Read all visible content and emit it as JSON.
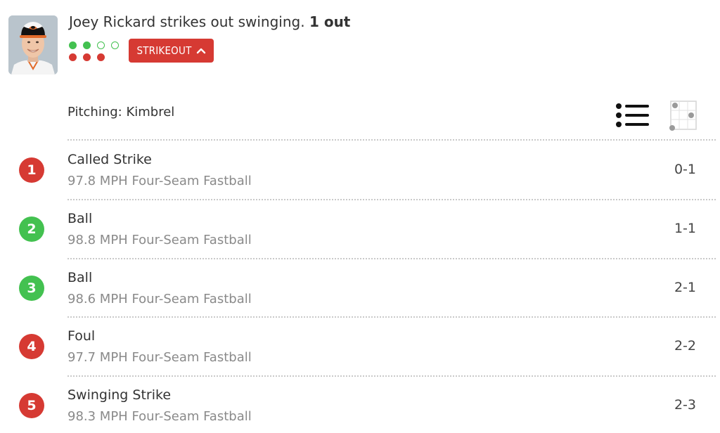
{
  "play": {
    "description": "Joey Rickard strikes out swinging.",
    "outs_text": "1 out",
    "result_badge": "STRIKEOUT",
    "balls": 2,
    "strikes": 3
  },
  "pitching": {
    "label": "Pitching: Kimbrel"
  },
  "view_toggle": {
    "list_icon": "list-icon",
    "zone_icon": "strike-zone-icon"
  },
  "pitches": [
    {
      "number": "1",
      "result": "Called Strike",
      "detail": "97.8 MPH Four-Seam Fastball",
      "count": "0-1",
      "color": "#d63a33"
    },
    {
      "number": "2",
      "result": "Ball",
      "detail": "98.8 MPH Four-Seam Fastball",
      "count": "1-1",
      "color": "#43c150"
    },
    {
      "number": "3",
      "result": "Ball",
      "detail": "98.6 MPH Four-Seam Fastball",
      "count": "2-1",
      "color": "#43c150"
    },
    {
      "number": "4",
      "result": "Foul",
      "detail": "97.7 MPH Four-Seam Fastball",
      "count": "2-2",
      "color": "#d63a33"
    },
    {
      "number": "5",
      "result": "Swinging Strike",
      "detail": "98.3 MPH Four-Seam Fastball",
      "count": "2-3",
      "color": "#d63a33"
    }
  ],
  "colors": {
    "ball": "#43c150",
    "strike": "#d63a33"
  }
}
